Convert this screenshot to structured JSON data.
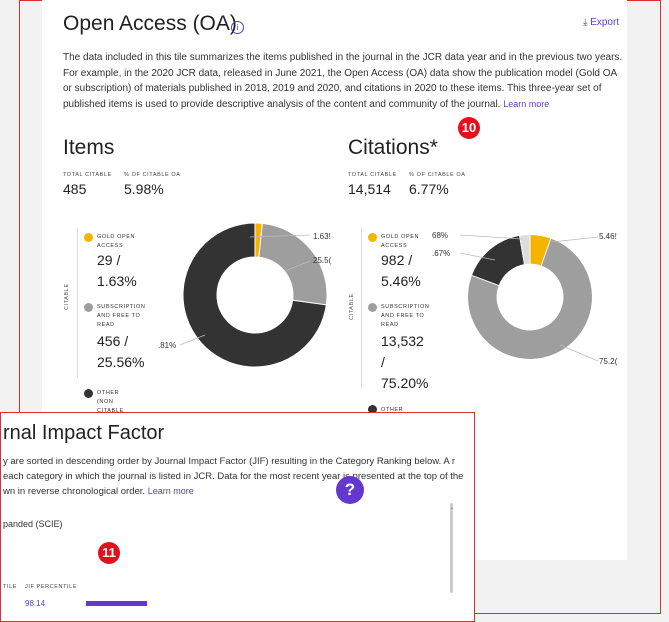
{
  "oa": {
    "title": "Open Access (OA)",
    "export_label": "Export",
    "description": "The data included in this tile summarizes the items published in the journal in the JCR data year and in the previous two years. For example, in the 2020 JCR data, released in June 2021, the Open Access (OA) data show the publication model (Gold OA or subscription) of materials published in 2018, 2019 and 2020, and citations in 2020 to these items. This three-year set of published items is used to provide descriptive analysis of the content and community of the journal.",
    "learn_more": "Learn more",
    "badge": "10",
    "items": {
      "heading": "Items",
      "total_label": "TOTAL CITABLE",
      "pct_label": "% OF CITABLE OA",
      "total_value": "485",
      "pct_value": "5.98%",
      "axis_label": "CITABLE",
      "legend": [
        {
          "label": "GOLD OPEN ACCESS",
          "value": "29 / 1.63%",
          "color": "#f5b400"
        },
        {
          "label": "SUBSCRIPTION AND FREE TO READ",
          "value": "456 / 25.56%",
          "color": "#9e9e9e"
        },
        {
          "label": "OTHER (NON CITABLE",
          "color": "#333333"
        }
      ],
      "chart_data": {
        "type": "pie",
        "slices": [
          {
            "label": "GOLD OPEN ACCESS",
            "value": 1.63,
            "color": "#f5b400"
          },
          {
            "label": "SUBSCRIPTION AND FREE TO READ",
            "value": 25.56,
            "color": "#9e9e9e"
          },
          {
            "label": "OTHER",
            "value": 72.81,
            "color": "#333333"
          }
        ]
      },
      "callouts": [
        "1.63!",
        "25.5(",
        ".81%"
      ]
    },
    "citations": {
      "heading": "Citations*",
      "total_label": "TOTAL CITABLE",
      "pct_label": "% OF CITABLE OA",
      "total_value": "14,514",
      "pct_value": "6.77%",
      "axis_label": "CITABLE",
      "legend": [
        {
          "label": "GOLD OPEN ACCESS",
          "value": "982 / 5.46%",
          "color": "#f5b400"
        },
        {
          "label": "SUBSCRIPTION AND FREE TO READ",
          "value": "13,532 / 75.20%",
          "color": "#9e9e9e"
        },
        {
          "label": "OTHER",
          "color": "#333333"
        }
      ],
      "chart_data": {
        "type": "pie",
        "slices": [
          {
            "label": "GOLD OPEN ACCESS",
            "value": 5.46,
            "color": "#f5b400"
          },
          {
            "label": "SUBSCRIPTION AND FREE TO READ",
            "value": 75.2,
            "color": "#9e9e9e"
          },
          {
            "label": "OTHER",
            "value": 16.66,
            "color": "#333333"
          },
          {
            "label": "",
            "value": 2.68,
            "color": "#dddddd"
          }
        ]
      },
      "callouts": [
        "68%",
        ".67%",
        "5.46!",
        "75.2("
      ]
    }
  },
  "jif": {
    "title": "rnal Impact Factor",
    "description": "y are sorted in descending order by Journal Impact Factor (JIF) resulting in the Category Ranking below. A r each category in which the journal is listed in JCR. Data for the most recent year is presented at the top of the wn in reverse chronological order.",
    "learn_more": "Learn more",
    "help_glyph": "?",
    "badge": "11",
    "edition": "panded (SCIE)",
    "col_a": "TILE",
    "col_b": "JIF PERCENTILE",
    "percentile_value": "98.14",
    "percentile_fraction": 0.98
  }
}
